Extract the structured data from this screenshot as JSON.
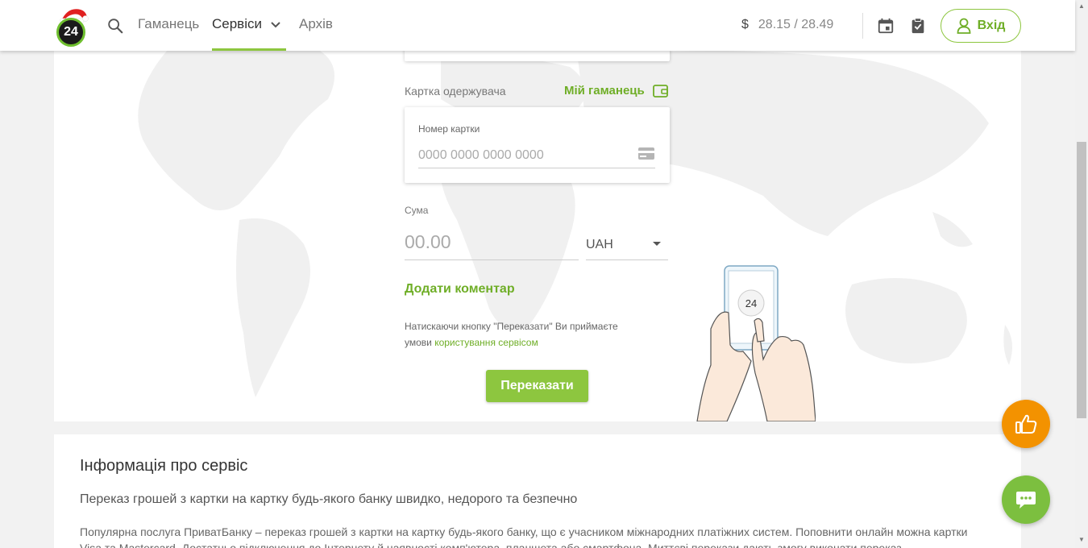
{
  "header": {
    "logo_text": "24",
    "nav": [
      {
        "label": "Гаманець"
      },
      {
        "label": "Сервіси"
      },
      {
        "label": "Архів"
      }
    ],
    "rate_currency": "$",
    "rate_value": "28.15 / 28.49",
    "login_label": "Вхід"
  },
  "form": {
    "recipient_label": "Картка одержувача",
    "wallet_link": "Мій гаманець",
    "card_number_label": "Номер картки",
    "card_number_placeholder": "0000 0000 0000 0000",
    "amount_label": "Сума",
    "amount_placeholder": "00.00",
    "currency": "UAH",
    "add_comment": "Додати коментар",
    "terms_prefix": "Натискаючи кнопку \"Переказати\" Ви приймаєте умови ",
    "terms_link": "користування сервісом",
    "submit_label": "Переказати",
    "phone_label": "24"
  },
  "info": {
    "title": "Інформація про сервіс",
    "subtitle": "Переказ грошей з картки на картку будь-якого банку швидко, недорого та безпечно",
    "text": "Популярна послуга ПриватБанку – переказ грошей з картки на картку будь-якого банку, що є учасником міжнародних платіжних систем. Поповнити онлайн можна картки Visa та Mastercard. Достатньо підключення до Інтернету й наявності комп'ютера, планшета або смартфона. Миттєві перекази дають змогу виконати переказ"
  },
  "colors": {
    "accent": "#8dc63f",
    "accent_text": "#6fae27",
    "like_button": "#f39200",
    "chat_button": "#7cbf3f"
  }
}
